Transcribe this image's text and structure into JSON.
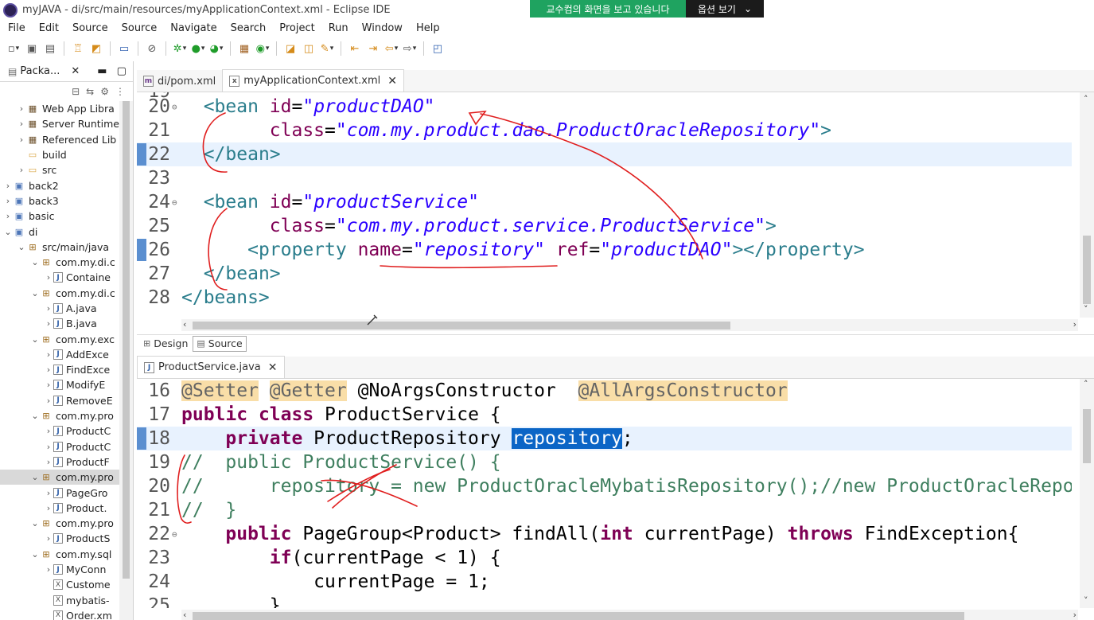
{
  "window": {
    "title": "myJAVA - di/src/main/resources/myApplicationContext.xml - Eclipse IDE"
  },
  "share_banner": {
    "text": "교수컴의 화면을 보고 있습니다",
    "option": "옵션 보기"
  },
  "menu": [
    "File",
    "Edit",
    "Source",
    "Source",
    "Navigate",
    "Search",
    "Project",
    "Run",
    "Window",
    "Help"
  ],
  "package_explorer": {
    "tab_label": "Packa...",
    "items": [
      {
        "arrow": ">",
        "indent": 2,
        "icon": "lib",
        "label": "Web App Libra"
      },
      {
        "arrow": ">",
        "indent": 2,
        "icon": "lib",
        "label": "Server Runtime"
      },
      {
        "arrow": ">",
        "indent": 2,
        "icon": "lib",
        "label": "Referenced Lib"
      },
      {
        "arrow": "",
        "indent": 2,
        "icon": "fold",
        "label": "build"
      },
      {
        "arrow": ">",
        "indent": 2,
        "icon": "fold",
        "label": "src"
      },
      {
        "arrow": ">",
        "indent": 1,
        "icon": "proj",
        "label": "back2"
      },
      {
        "arrow": ">",
        "indent": 1,
        "icon": "proj",
        "label": "back3"
      },
      {
        "arrow": ">",
        "indent": 1,
        "icon": "proj",
        "label": "basic"
      },
      {
        "arrow": "v",
        "indent": 1,
        "icon": "proj",
        "label": "di"
      },
      {
        "arrow": "v",
        "indent": 2,
        "icon": "pkg",
        "label": "src/main/java"
      },
      {
        "arrow": "v",
        "indent": 3,
        "icon": "pkg",
        "label": "com.my.di.c"
      },
      {
        "arrow": ">",
        "indent": 4,
        "icon": "java",
        "label": "Containe"
      },
      {
        "arrow": "v",
        "indent": 3,
        "icon": "pkg",
        "label": "com.my.di.c"
      },
      {
        "arrow": ">",
        "indent": 4,
        "icon": "java",
        "label": "A.java"
      },
      {
        "arrow": ">",
        "indent": 4,
        "icon": "java",
        "label": "B.java"
      },
      {
        "arrow": "v",
        "indent": 3,
        "icon": "pkg",
        "label": "com.my.exc"
      },
      {
        "arrow": ">",
        "indent": 4,
        "icon": "java",
        "label": "AddExce"
      },
      {
        "arrow": ">",
        "indent": 4,
        "icon": "java",
        "label": "FindExce"
      },
      {
        "arrow": ">",
        "indent": 4,
        "icon": "java",
        "label": "ModifyE"
      },
      {
        "arrow": ">",
        "indent": 4,
        "icon": "java",
        "label": "RemoveE"
      },
      {
        "arrow": "v",
        "indent": 3,
        "icon": "pkg",
        "label": "com.my.pro"
      },
      {
        "arrow": ">",
        "indent": 4,
        "icon": "java",
        "label": "ProductC"
      },
      {
        "arrow": ">",
        "indent": 4,
        "icon": "java",
        "label": "ProductC"
      },
      {
        "arrow": ">",
        "indent": 4,
        "icon": "java",
        "label": "ProductF"
      },
      {
        "arrow": "v",
        "indent": 3,
        "icon": "pkg",
        "label": "com.my.pro",
        "selected": true
      },
      {
        "arrow": ">",
        "indent": 4,
        "icon": "java",
        "label": "PageGro"
      },
      {
        "arrow": ">",
        "indent": 4,
        "icon": "java",
        "label": "Product."
      },
      {
        "arrow": "v",
        "indent": 3,
        "icon": "pkg",
        "label": "com.my.pro"
      },
      {
        "arrow": ">",
        "indent": 4,
        "icon": "java",
        "label": "ProductS"
      },
      {
        "arrow": "v",
        "indent": 3,
        "icon": "pkg",
        "label": "com.my.sql"
      },
      {
        "arrow": ">",
        "indent": 4,
        "icon": "java",
        "label": "MyConn"
      },
      {
        "arrow": "",
        "indent": 4,
        "icon": "xml",
        "label": "Custome"
      },
      {
        "arrow": "",
        "indent": 4,
        "icon": "xml",
        "label": "mybatis-"
      },
      {
        "arrow": "",
        "indent": 4,
        "icon": "xml",
        "label": "Order.xm"
      }
    ]
  },
  "editor_xml": {
    "tabs": [
      {
        "label": "di/pom.xml",
        "icon": "m",
        "active": false
      },
      {
        "label": "myApplicationContext.xml",
        "icon": "x",
        "active": true
      }
    ],
    "partial_line": "19",
    "lines": [
      {
        "n": "20",
        "fold": "⊖",
        "tokens": [
          [
            "pl",
            "  "
          ],
          [
            "tg",
            "<bean "
          ],
          [
            "at",
            "id"
          ],
          [
            "pl",
            "="
          ],
          [
            "av",
            "\"productDAO\""
          ]
        ]
      },
      {
        "n": "21",
        "fold": "",
        "tokens": [
          [
            "pl",
            "        "
          ],
          [
            "at",
            "class"
          ],
          [
            "pl",
            "="
          ],
          [
            "av",
            "\"com.my.product.dao.ProductOracleRepository\""
          ],
          [
            "tg",
            ">"
          ]
        ]
      },
      {
        "n": "22",
        "fold": "",
        "hl": true,
        "tokens": [
          [
            "pl",
            "  "
          ],
          [
            "tg",
            "</bean>"
          ]
        ]
      },
      {
        "n": "23",
        "fold": "",
        "tokens": []
      },
      {
        "n": "24",
        "fold": "⊖",
        "tokens": [
          [
            "pl",
            "  "
          ],
          [
            "tg",
            "<bean "
          ],
          [
            "at",
            "id"
          ],
          [
            "pl",
            "="
          ],
          [
            "av",
            "\"productService\""
          ]
        ]
      },
      {
        "n": "25",
        "fold": "",
        "tokens": [
          [
            "pl",
            "        "
          ],
          [
            "at",
            "class"
          ],
          [
            "pl",
            "="
          ],
          [
            "av",
            "\"com.my.product.service.ProductService\""
          ],
          [
            "tg",
            ">"
          ]
        ]
      },
      {
        "n": "26",
        "fold": "",
        "tokens": [
          [
            "pl",
            "      "
          ],
          [
            "tg",
            "<property "
          ],
          [
            "at",
            "name"
          ],
          [
            "pl",
            "="
          ],
          [
            "av",
            "\"repository\""
          ],
          [
            "pl",
            " "
          ],
          [
            "at",
            "ref"
          ],
          [
            "pl",
            "="
          ],
          [
            "av",
            "\"productDAO\""
          ],
          [
            "tg",
            "></property>"
          ]
        ]
      },
      {
        "n": "27",
        "fold": "",
        "tokens": [
          [
            "pl",
            "  "
          ],
          [
            "tg",
            "</bean>"
          ]
        ]
      },
      {
        "n": "28",
        "fold": "",
        "tokens": [
          [
            "tg",
            "</beans>"
          ]
        ]
      }
    ]
  },
  "design_source_tabs": [
    {
      "label": "Design",
      "active": false
    },
    {
      "label": "Source",
      "active": true
    }
  ],
  "editor_java": {
    "tabs": [
      {
        "label": "ProductService.java",
        "icon": "J",
        "active": true
      }
    ],
    "lines": [
      {
        "n": "16",
        "fold": "",
        "tokens": [
          [
            "an",
            "@Setter"
          ],
          [
            "pl",
            " "
          ],
          [
            "an",
            "@Getter"
          ],
          [
            "pl",
            " "
          ],
          [
            "ty",
            "@NoArgsConstructor"
          ],
          [
            "pl",
            "  "
          ],
          [
            "an",
            "@AllArgsConstructor"
          ]
        ]
      },
      {
        "n": "17",
        "fold": "",
        "tokens": [
          [
            "kw",
            "public"
          ],
          [
            "pl",
            " "
          ],
          [
            "kw",
            "class"
          ],
          [
            "pl",
            " ProductService {"
          ]
        ]
      },
      {
        "n": "18",
        "fold": "",
        "hl": true,
        "tokens": [
          [
            "pl",
            "    "
          ],
          [
            "kw",
            "private"
          ],
          [
            "pl",
            " ProductRepository "
          ],
          [
            "sel",
            "repository"
          ],
          [
            "pl",
            ";"
          ]
        ]
      },
      {
        "n": "19",
        "fold": "",
        "tokens": [
          [
            "cm",
            "//  public ProductService() {"
          ]
        ]
      },
      {
        "n": "20",
        "fold": "",
        "tokens": [
          [
            "cm",
            "//      repository = new ProductOracleMybatisRepository();//new ProductOracleRepo"
          ]
        ]
      },
      {
        "n": "21",
        "fold": "",
        "tokens": [
          [
            "cm",
            "//  }"
          ]
        ]
      },
      {
        "n": "22",
        "fold": "⊖",
        "tokens": [
          [
            "pl",
            "    "
          ],
          [
            "kw",
            "public"
          ],
          [
            "pl",
            " PageGroup<Product> findAll("
          ],
          [
            "kw",
            "int"
          ],
          [
            "pl",
            " currentPage) "
          ],
          [
            "kw",
            "throws"
          ],
          [
            "pl",
            " FindException{"
          ]
        ]
      },
      {
        "n": "23",
        "fold": "",
        "tokens": [
          [
            "pl",
            "        "
          ],
          [
            "kw",
            "if"
          ],
          [
            "pl",
            "(currentPage < 1) {"
          ]
        ]
      },
      {
        "n": "24",
        "fold": "",
        "tokens": [
          [
            "pl",
            "            currentPage = 1;"
          ]
        ]
      },
      {
        "n": "25",
        "fold": "",
        "tokens": [
          [
            "pl",
            "        }"
          ]
        ]
      }
    ]
  },
  "colors": {
    "tag": "#2a7d8c",
    "attr_name": "#7f0055",
    "attr_value": "#2a00ff",
    "keyword": "#7f0055",
    "comment": "#3f7f5f",
    "annotation_bg": "#f9dea8",
    "selection": "#0b65c6",
    "banner_green": "#1fa360",
    "annotation_ink": "#e01e1e"
  }
}
